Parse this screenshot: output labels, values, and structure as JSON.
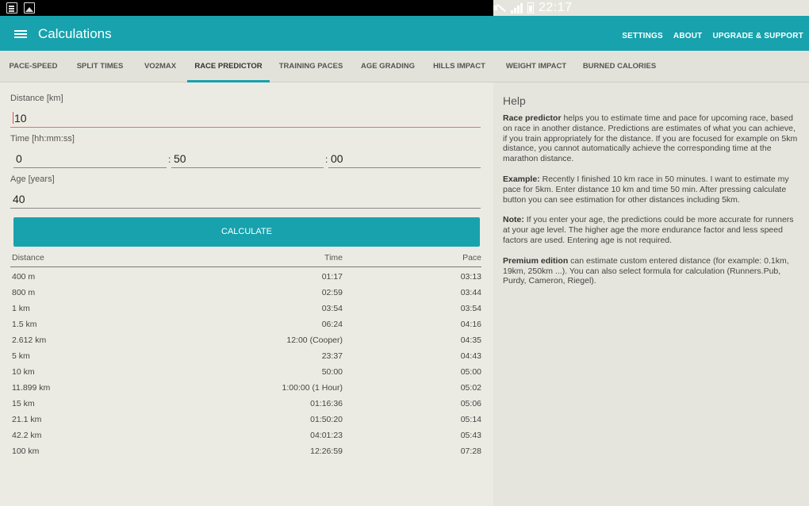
{
  "status_bar": {
    "time": "22:17"
  },
  "app_bar": {
    "title": "Calculations",
    "actions": [
      "SETTINGS",
      "ABOUT",
      "UPGRADE & SUPPORT"
    ]
  },
  "tabs": [
    "PACE-SPEED",
    "SPLIT TIMES",
    "VO2MAX",
    "RACE PREDICTOR",
    "TRAINING PACES",
    "AGE GRADING",
    "HILLS IMPACT",
    "WEIGHT IMPACT",
    "BURNED CALORIES"
  ],
  "active_tab": "RACE PREDICTOR",
  "form": {
    "distance_label": "Distance [km]",
    "distance_value": "10",
    "time_label": "Time [hh:mm:ss]",
    "time_hours": "0",
    "time_minutes": "50",
    "time_seconds": "00",
    "time_separator": ":",
    "age_label": "Age [years]",
    "age_value": "40",
    "calculate_label": "CALCULATE"
  },
  "table": {
    "headers": {
      "distance": "Distance",
      "time": "Time",
      "pace": "Pace"
    },
    "rows": [
      {
        "distance": "400 m",
        "time": "01:17",
        "pace": "03:13"
      },
      {
        "distance": "800 m",
        "time": "02:59",
        "pace": "03:44"
      },
      {
        "distance": "1 km",
        "time": "03:54",
        "pace": "03:54"
      },
      {
        "distance": "1.5 km",
        "time": "06:24",
        "pace": "04:16"
      },
      {
        "distance": "2.612 km",
        "time": "12:00 (Cooper)",
        "pace": "04:35"
      },
      {
        "distance": "5 km",
        "time": "23:37",
        "pace": "04:43"
      },
      {
        "distance": "10 km",
        "time": "50:00",
        "pace": "05:00"
      },
      {
        "distance": "11.899 km",
        "time": "1:00:00 (1 Hour)",
        "pace": "05:02"
      },
      {
        "distance": "15 km",
        "time": "01:16:36",
        "pace": "05:06"
      },
      {
        "distance": "21.1 km",
        "time": "01:50:20",
        "pace": "05:14"
      },
      {
        "distance": "42.2 km",
        "time": "04:01:23",
        "pace": "05:43"
      },
      {
        "distance": "100 km",
        "time": "12:26:59",
        "pace": "07:28"
      }
    ]
  },
  "help": {
    "title": "Help",
    "p1_bold": "Race predictor",
    "p1_text": " helps you to estimate time and pace for upcoming race, based on race in another distance. Predictions are estimates of what you can achieve, if you train appropriately for the distance. If you are focused for example on 5km distance, you cannot automatically achieve the corresponding time at the marathon distance.",
    "p2_bold": "Example:",
    "p2_text": " Recently I finished 10 km race in 50 minutes. I want to estimate my pace for 5km. Enter distance 10 km and time 50 min. After pressing calculate button you can see estimation for other distances including 5km.",
    "p3_bold": "Note:",
    "p3_text": " If you enter your age, the predictions could be more accurate for runners at your age level. The higher age the more endurance factor and less speed factors are used. Entering age is not required.",
    "p4_bold": "Premium edition",
    "p4_text": " can estimate custom entered distance (for example: 0.1km, 19km, 250km ...). You can also select formula for calculation (Runners.Pub, Purdy, Cameron, Riegel)."
  },
  "colors": {
    "accent": "#17a2ad",
    "focus_underline": "#e57373"
  }
}
